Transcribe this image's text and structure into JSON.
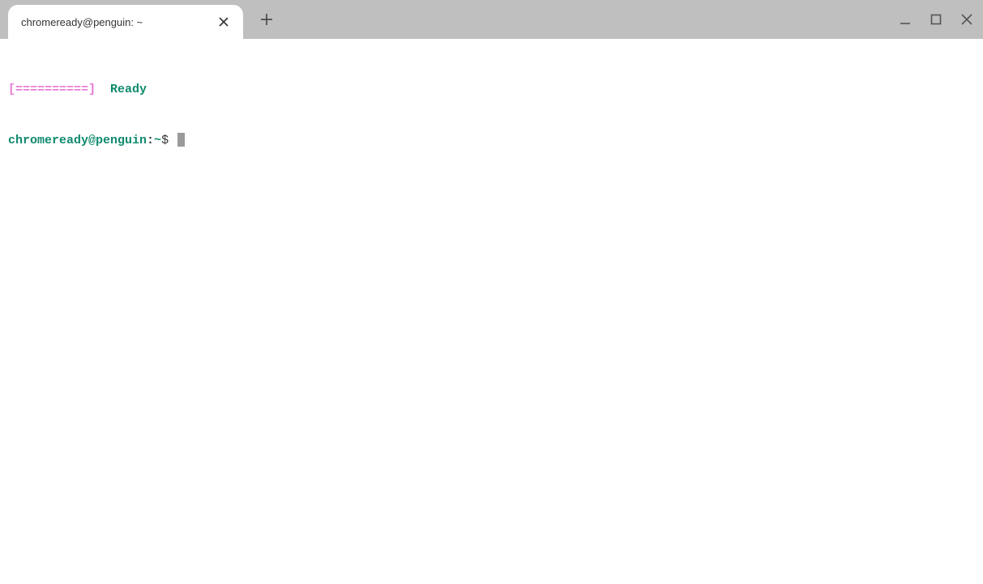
{
  "tabs": {
    "active": {
      "title": "chromeready@penguin: ~"
    }
  },
  "terminal": {
    "line1": {
      "progress_bar": "[==========]",
      "status": "Ready"
    },
    "prompt": {
      "user_host": "chromeready@penguin",
      "separator": ":",
      "path": "~",
      "symbol": "$"
    }
  }
}
